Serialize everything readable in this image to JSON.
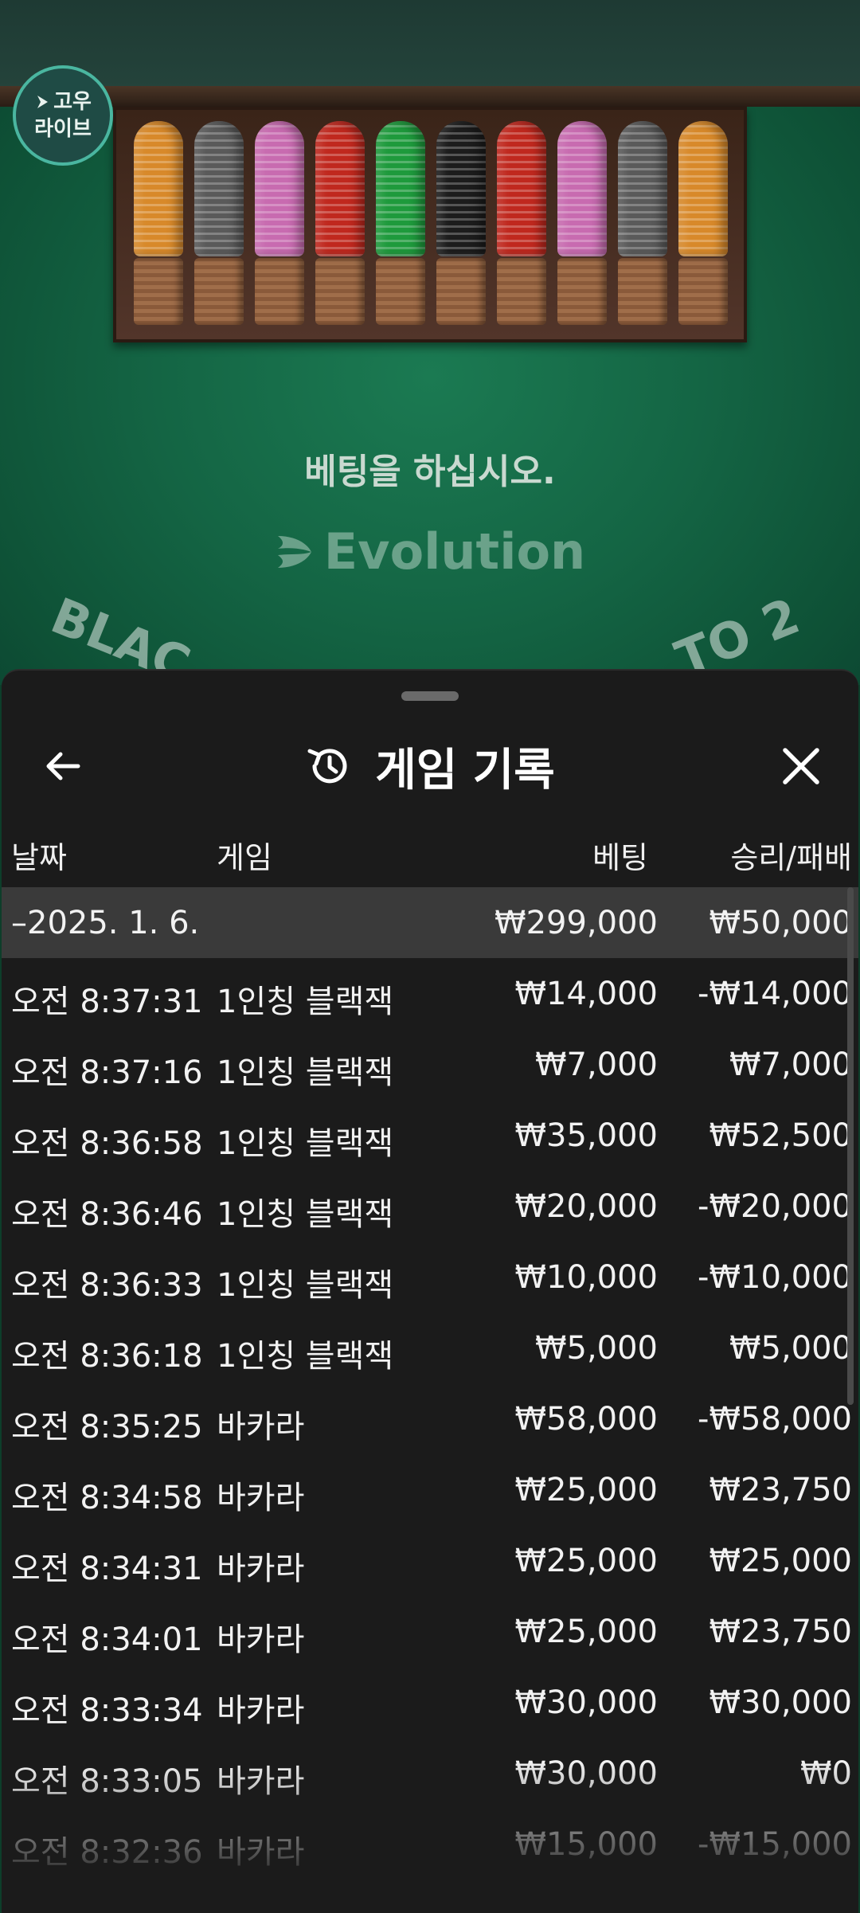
{
  "logo": {
    "line1": "고우",
    "line2": "라이브"
  },
  "table": {
    "prompt": "베팅을 하십시오.",
    "brand": "Evolution",
    "arc_left": "BLAC",
    "arc_right": "TO 2",
    "chip_colors": [
      "#d8892a",
      "#5a5a5a",
      "#c86bb0",
      "#c0281e",
      "#1e9a3c",
      "#1c1c1c",
      "#c0281e",
      "#c86bb0",
      "#5a5a5a",
      "#d8892a"
    ]
  },
  "sheet": {
    "title": "게임 기록",
    "back_icon": "arrow-left-icon",
    "history_icon": "history-icon",
    "close_icon": "close-icon"
  },
  "columns": {
    "date": "날짜",
    "game": "게임",
    "bet": "베팅",
    "winloss": "승리/패배"
  },
  "summary": {
    "date": "–2025. 1. 6.",
    "bet": "₩299,000",
    "winloss": "₩50,000"
  },
  "rows": [
    {
      "time": "오전 8:37:31",
      "game": "1인칭 블랙잭",
      "bet": "₩14,000",
      "winloss": "-₩14,000"
    },
    {
      "time": "오전 8:37:16",
      "game": "1인칭 블랙잭",
      "bet": "₩7,000",
      "winloss": "₩7,000"
    },
    {
      "time": "오전 8:36:58",
      "game": "1인칭 블랙잭",
      "bet": "₩35,000",
      "winloss": "₩52,500"
    },
    {
      "time": "오전 8:36:46",
      "game": "1인칭 블랙잭",
      "bet": "₩20,000",
      "winloss": "-₩20,000"
    },
    {
      "time": "오전 8:36:33",
      "game": "1인칭 블랙잭",
      "bet": "₩10,000",
      "winloss": "-₩10,000"
    },
    {
      "time": "오전 8:36:18",
      "game": "1인칭 블랙잭",
      "bet": "₩5,000",
      "winloss": "₩5,000"
    },
    {
      "time": "오전 8:35:25",
      "game": "바카라",
      "bet": "₩58,000",
      "winloss": "-₩58,000"
    },
    {
      "time": "오전 8:34:58",
      "game": "바카라",
      "bet": "₩25,000",
      "winloss": "₩23,750"
    },
    {
      "time": "오전 8:34:31",
      "game": "바카라",
      "bet": "₩25,000",
      "winloss": "₩25,000"
    },
    {
      "time": "오전 8:34:01",
      "game": "바카라",
      "bet": "₩25,000",
      "winloss": "₩23,750"
    },
    {
      "time": "오전 8:33:34",
      "game": "바카라",
      "bet": "₩30,000",
      "winloss": "₩30,000"
    },
    {
      "time": "오전 8:33:05",
      "game": "바카라",
      "bet": "₩30,000",
      "winloss": "₩0"
    },
    {
      "time": "오전 8:32:36",
      "game": "바카라",
      "bet": "₩15,000",
      "winloss": "-₩15,000"
    }
  ]
}
